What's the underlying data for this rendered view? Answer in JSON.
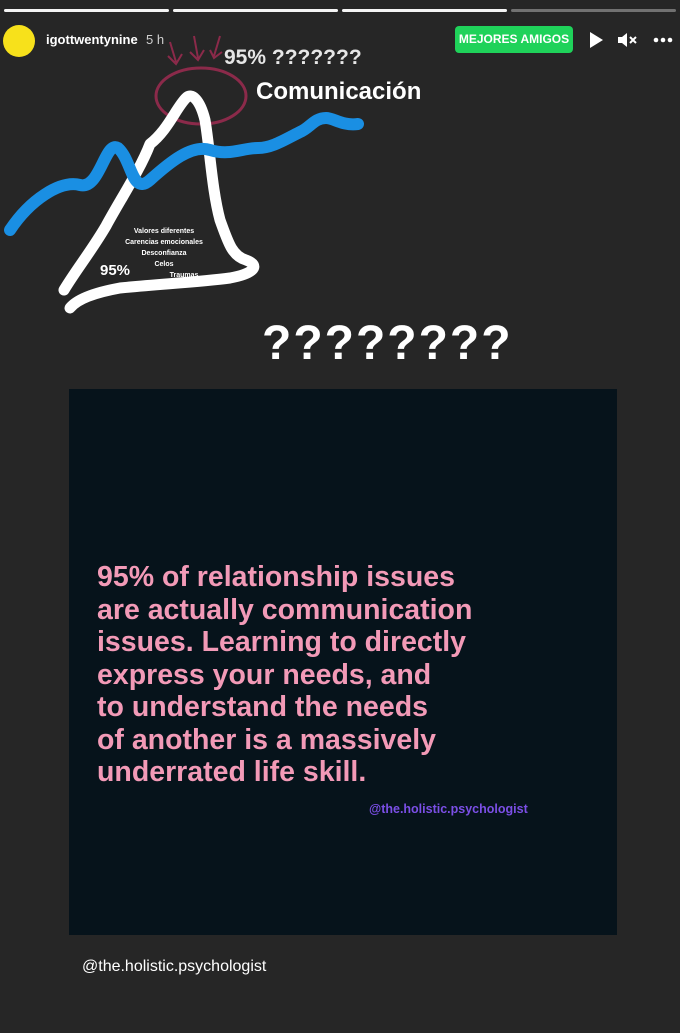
{
  "story": {
    "username": "igottwentynine",
    "time": "5 h",
    "badge": "MEJORES AMIGOS",
    "progress_segments": 4,
    "icons": {
      "play": "play-icon",
      "mute": "mute-icon",
      "more": "more-icon"
    }
  },
  "overlay": {
    "percent_label": "95% ???????",
    "communication_label": "Comunicación",
    "issues_list": [
      "Valores diferentes",
      "Carencias emocionales",
      "Desconfianza",
      "Celos",
      "Traumas"
    ],
    "percent_small": "95%",
    "questions": "????????"
  },
  "card": {
    "quote_lines": [
      "95% of relationship issues",
      "are actually communication",
      "issues. Learning to directly",
      "express your needs, and",
      "to understand the needs",
      "of another is a massively",
      "underrated life skill."
    ],
    "credit": "@the.holistic.psychologist"
  },
  "caption": "@the.holistic.psychologist",
  "colors": {
    "background": "#262626",
    "avatar": "#f7e11b",
    "badge": "#1fd25a",
    "quote": "#f29ab7",
    "credit": "#7b4fe6",
    "blue_line": "#1a8fe3",
    "circle": "#8b2a4a"
  }
}
